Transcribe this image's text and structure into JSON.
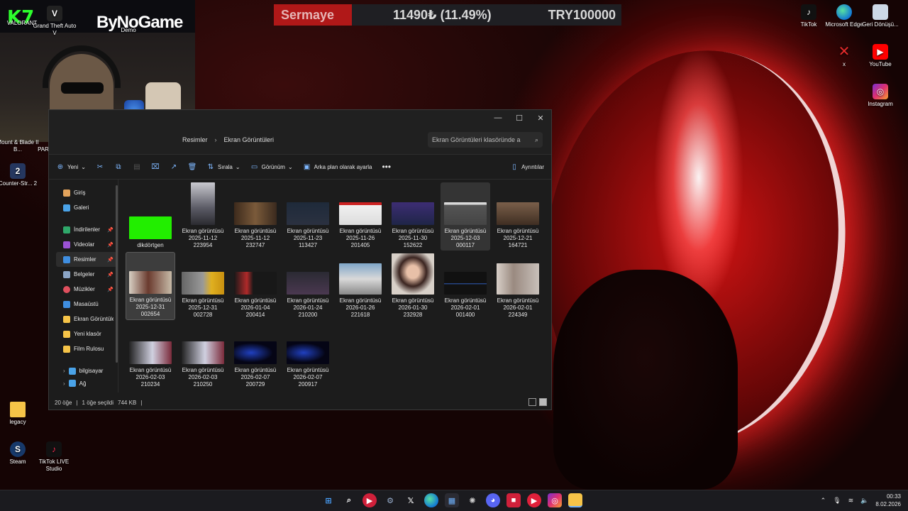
{
  "overlay": {
    "logo": "K7",
    "brand": "ByNoGame"
  },
  "ticker": {
    "label": "Sermaye",
    "change": "11490₺ (11.49%)",
    "total": "TRY100000"
  },
  "desktop_icons": {
    "gta": "Grand Theft Auto V",
    "valorant": "VALORANT",
    "demo": "Demo",
    "mount_blade": "Mount & Blade II B...",
    "par": "PAR",
    "counter_strike": "Counter-Str... 2",
    "legacy": "legacy",
    "steam": "Steam",
    "tiktok_live": "TikTok LIVE Studio",
    "tiktok": "TikTok",
    "edge": "Microsoft Edge",
    "recycle_bin": "Geri Dönüşü...",
    "x_app": "x",
    "youtube": "YouTube",
    "instagram": "Instagram"
  },
  "explorer": {
    "breadcrumb_parent": "Resimler",
    "breadcrumb_current": "Ekran Görüntüleri",
    "search_placeholder": "Ekran Görüntüleri klasöründe a",
    "toolbar": {
      "new": "Yeni",
      "sort": "Sırala",
      "view": "Görünüm",
      "set_background": "Arka plan olarak ayarla",
      "details": "Ayrıntılar"
    },
    "nav": {
      "home": "Giriş",
      "gallery": "Galeri",
      "downloads": "İndirilenler",
      "videos": "Videolar",
      "pictures": "Resimler",
      "documents": "Belgeler",
      "music": "Müzikler",
      "desktop": "Masaüstü",
      "screenshots": "Ekran Görüntüleri",
      "new_folder": "Yeni klasör",
      "film_roll": "Film Rulosu",
      "this_pc": "bilgisayar",
      "network": "Ağ"
    },
    "files": [
      {
        "line1": "dikdörtgen",
        "line2": "",
        "line3": ""
      },
      {
        "line1": "Ekran görüntüsü",
        "line2": "2025-11-12",
        "line3": "223954"
      },
      {
        "line1": "Ekran görüntüsü",
        "line2": "2025-11-12",
        "line3": "232747"
      },
      {
        "line1": "Ekran görüntüsü",
        "line2": "2025-11-23",
        "line3": "113427"
      },
      {
        "line1": "Ekran görüntüsü",
        "line2": "2025-11-26",
        "line3": "201405"
      },
      {
        "line1": "Ekran görüntüsü",
        "line2": "2025-11-30",
        "line3": "152622"
      },
      {
        "line1": "Ekran görüntüsü",
        "line2": "2025-12-03",
        "line3": "000117"
      },
      {
        "line1": "Ekran görüntüsü",
        "line2": "2025-12-21",
        "line3": "164721"
      },
      {
        "line1": "Ekran görüntüsü",
        "line2": "2025-12-31",
        "line3": "002654"
      },
      {
        "line1": "Ekran görüntüsü",
        "line2": "2025-12-31",
        "line3": "002728"
      },
      {
        "line1": "Ekran görüntüsü",
        "line2": "2026-01-04",
        "line3": "200414"
      },
      {
        "line1": "Ekran görüntüsü",
        "line2": "2026-01-24",
        "line3": "210200"
      },
      {
        "line1": "Ekran görüntüsü",
        "line2": "2026-01-26",
        "line3": "221618"
      },
      {
        "line1": "Ekran görüntüsü",
        "line2": "2026-01-30",
        "line3": "232928"
      },
      {
        "line1": "Ekran görüntüsü",
        "line2": "2026-02-01",
        "line3": "001400"
      },
      {
        "line1": "Ekran görüntüsü",
        "line2": "2026-02-01",
        "line3": "224349"
      },
      {
        "line1": "Ekran görüntüsü",
        "line2": "2026-02-03",
        "line3": "210234"
      },
      {
        "line1": "Ekran görüntüsü",
        "line2": "2026-02-03",
        "line3": "210250"
      },
      {
        "line1": "Ekran görüntüsü",
        "line2": "2026-02-07",
        "line3": "200729"
      },
      {
        "line1": "Ekran görüntüsü",
        "line2": "2026-02-07",
        "line3": "200917"
      }
    ],
    "status": {
      "count": "20 öğe",
      "selected": "1 öğe seçildi",
      "size": "744 KB"
    }
  },
  "taskbar": {
    "time": "00:33",
    "date": "8.02.2026"
  },
  "colors": {
    "accent": "#6fb3ff",
    "ticker_red": "#b01818",
    "green_rect": "#22ee00"
  }
}
